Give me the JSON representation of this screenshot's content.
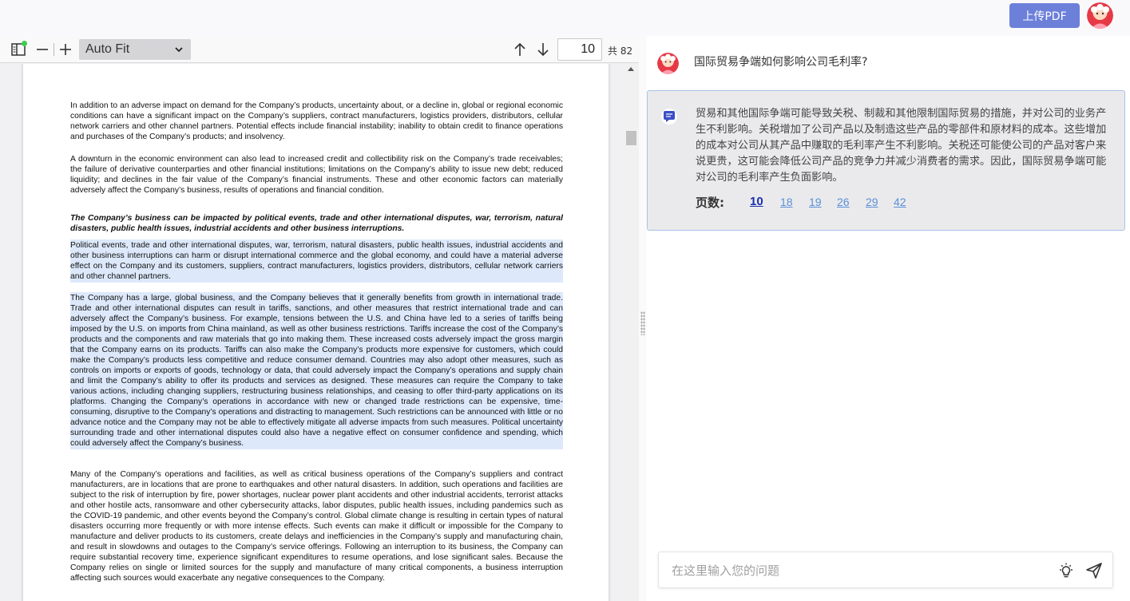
{
  "header": {
    "upload_label": "上传PDF"
  },
  "pdf_toolbar": {
    "zoom_value": "Auto Fit",
    "page_number": "10",
    "page_total": "共 82"
  },
  "pdf_page": {
    "paragraphs": [
      "In addition to an adverse impact on demand for the Company’s products, uncertainty about, or a decline in, global or regional economic conditions can have a significant impact on the Company’s suppliers, contract manufacturers, logistics providers, distributors, cellular network carriers and other channel partners. Potential effects include financial instability; inability to obtain credit to finance operations and purchases of the Company’s products; and insolvency.",
      "A downturn in the economic environment can also lead to increased credit and collectibility risk on the Company’s trade receivables; the failure of derivative counterparties and other financial institutions; limitations on the Company’s ability to issue new debt; reduced liquidity; and declines in the fair value of the Company’s financial instruments. These and other economic factors can materially adversely affect the Company’s business, results of operations and financial condition.",
      "The Company’s business can be impacted by political events, trade and other international disputes, war, terrorism, natural disasters, public health issues, industrial accidents and other business interruptions.",
      "Political events, trade and other international disputes, war, terrorism, natural disasters, public health issues, industrial accidents and other business interruptions can harm or disrupt international commerce and the global economy, and could have a material adverse effect on the Company and its customers, suppliers, contract manufacturers, logistics providers, distributors, cellular network carriers and other channel partners.",
      "The Company has a large, global business, and the Company believes that it generally benefits from growth in international trade. Trade and other international disputes can result in tariffs, sanctions, and other measures that restrict international trade and can adversely affect the Company’s business. For example, tensions between the U.S. and China have led to a series of tariffs being imposed by the U.S. on imports from China mainland, as well as other business restrictions. Tariffs increase the cost of the Company’s products and the components and raw materials that go into making them. These increased costs adversely impact the gross margin that the Company earns on its products. Tariffs can also make the Company’s products more expensive for customers, which could make the Company’s products less competitive and reduce consumer demand. Countries may also adopt other measures, such as controls on imports or exports of goods, technology or data, that could adversely impact the Company’s operations and supply chain and limit the Company’s ability to offer its products and services as designed. These measures can require the Company to take various actions, including changing suppliers, restructuring business relationships, and ceasing to offer third-party applications on its platforms. Changing the Company’s operations in accordance with new or changed trade restrictions can be expensive, time-consuming, disruptive to the Company’s operations and distracting to management. Such restrictions can be announced with little or no advance notice and the Company may not be able to effectively mitigate all adverse impacts from such measures. Political uncertainty surrounding trade and other international disputes could also have a negative effect on consumer confidence and spending, which could adversely affect the Company’s business.",
      "Many of the Company’s operations and facilities, as well as critical business operations of the Company’s suppliers and contract manufacturers, are in locations that are prone to earthquakes and other natural disasters. In addition, such operations and facilities are subject to the risk of interruption by fire, power shortages, nuclear power plant accidents and other industrial accidents, terrorist attacks and other hostile acts, ransomware and other cybersecurity attacks, labor disputes, public health issues, including pandemics such as the COVID-19 pandemic, and other events beyond the Company’s control. Global climate change is resulting in certain types of natural disasters occurring more frequently or with more intense effects. Such events can make it difficult or impossible for the Company to manufacture and deliver products to its customers, create delays and inefficiencies in the Company’s supply and manufacturing chain, and result in slowdowns and outages to the Company’s service offerings. Following an interruption to its business, the Company can require substantial recovery time, experience significant expenditures to resume operations, and lose significant sales. Because the Company relies on single or limited sources for the supply and manufacture of many critical components, a business interruption affecting such sources would exacerbate any negative consequences to the Company."
    ]
  },
  "chat": {
    "question": "国际贸易争端如何影响公司毛利率?",
    "answer": "贸易和其他国际争端可能导致关税、制裁和其他限制国际贸易的措施，并对公司的业务产生不利影响。关税增加了公司产品以及制造这些产品的零部件和原材料的成本。这些增加的成本对公司从其产品中赚取的毛利率产生不利影响。关税还可能使公司的产品对客户来说更贵，这可能会降低公司产品的竞争力并减少消费者的需求。因此，国际贸易争端可能对公司的毛利率产生负面影响。",
    "pages_label": "页数:",
    "page_links": [
      "10",
      "18",
      "19",
      "26",
      "29",
      "42"
    ],
    "input_placeholder": "在这里输入您的问题"
  },
  "colors": {
    "accent": "#6c7fd9",
    "highlight": "#dde9fb",
    "link": "#5b8fd8",
    "active_link": "#1a2fb0",
    "card_border": "#a8c4e8"
  },
  "icons": [
    "sidebar-toggle-icon",
    "zoom-out-icon",
    "zoom-in-icon",
    "chevron-down-icon",
    "arrow-up-icon",
    "arrow-down-icon",
    "avatar-icon",
    "chat-bubble-icon",
    "lightbulb-icon",
    "send-icon"
  ]
}
